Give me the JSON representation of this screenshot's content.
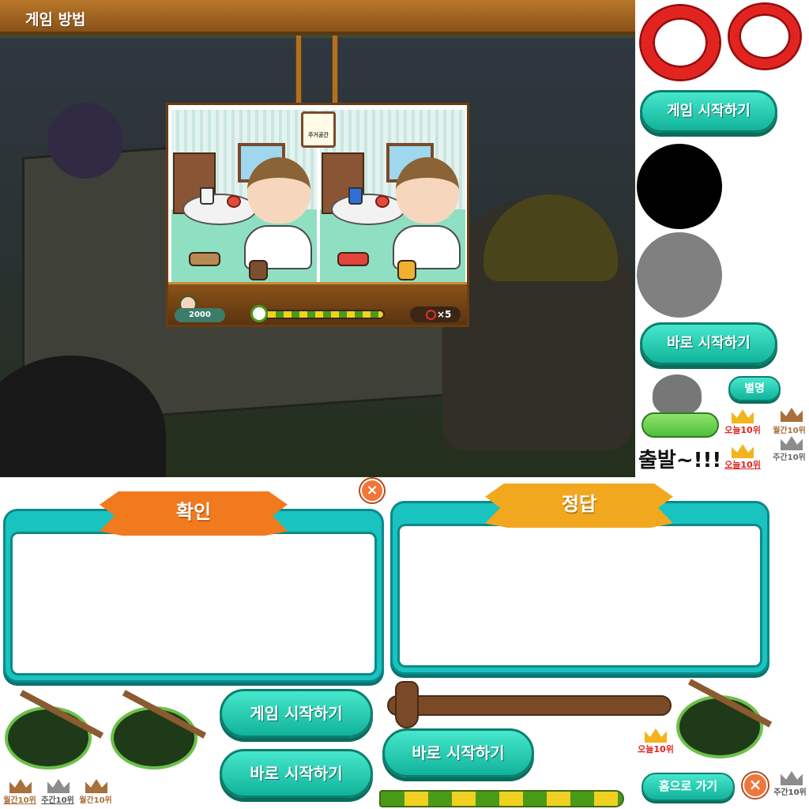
{
  "tutorial": {
    "title": "게임 방법",
    "sign_text": "주거공간",
    "score": "2000",
    "lives": "×5"
  },
  "buttons": {
    "start_game": "게임 시작하기",
    "quick_start": "바로 시작하기",
    "nickname": "별명",
    "home": "홈으로 가기",
    "close": "×"
  },
  "dialogs": {
    "confirm_title": "확인",
    "answer_title": "정답"
  },
  "ranks": {
    "today": "오늘10위",
    "weekly": "주간10위",
    "monthly": "월간10위"
  },
  "depart_text": "출발~!!!",
  "colors": {
    "accent_teal": "#19c3c0",
    "ring_red": "#e3231f",
    "ribbon_orange": "#f27a1e",
    "ribbon_gold": "#f2a81e",
    "gold_crown": "#f2b51e",
    "silver_crown": "#8c8c8c",
    "bronze_crown": "#a8703a",
    "rank_red": "#e0241c"
  }
}
